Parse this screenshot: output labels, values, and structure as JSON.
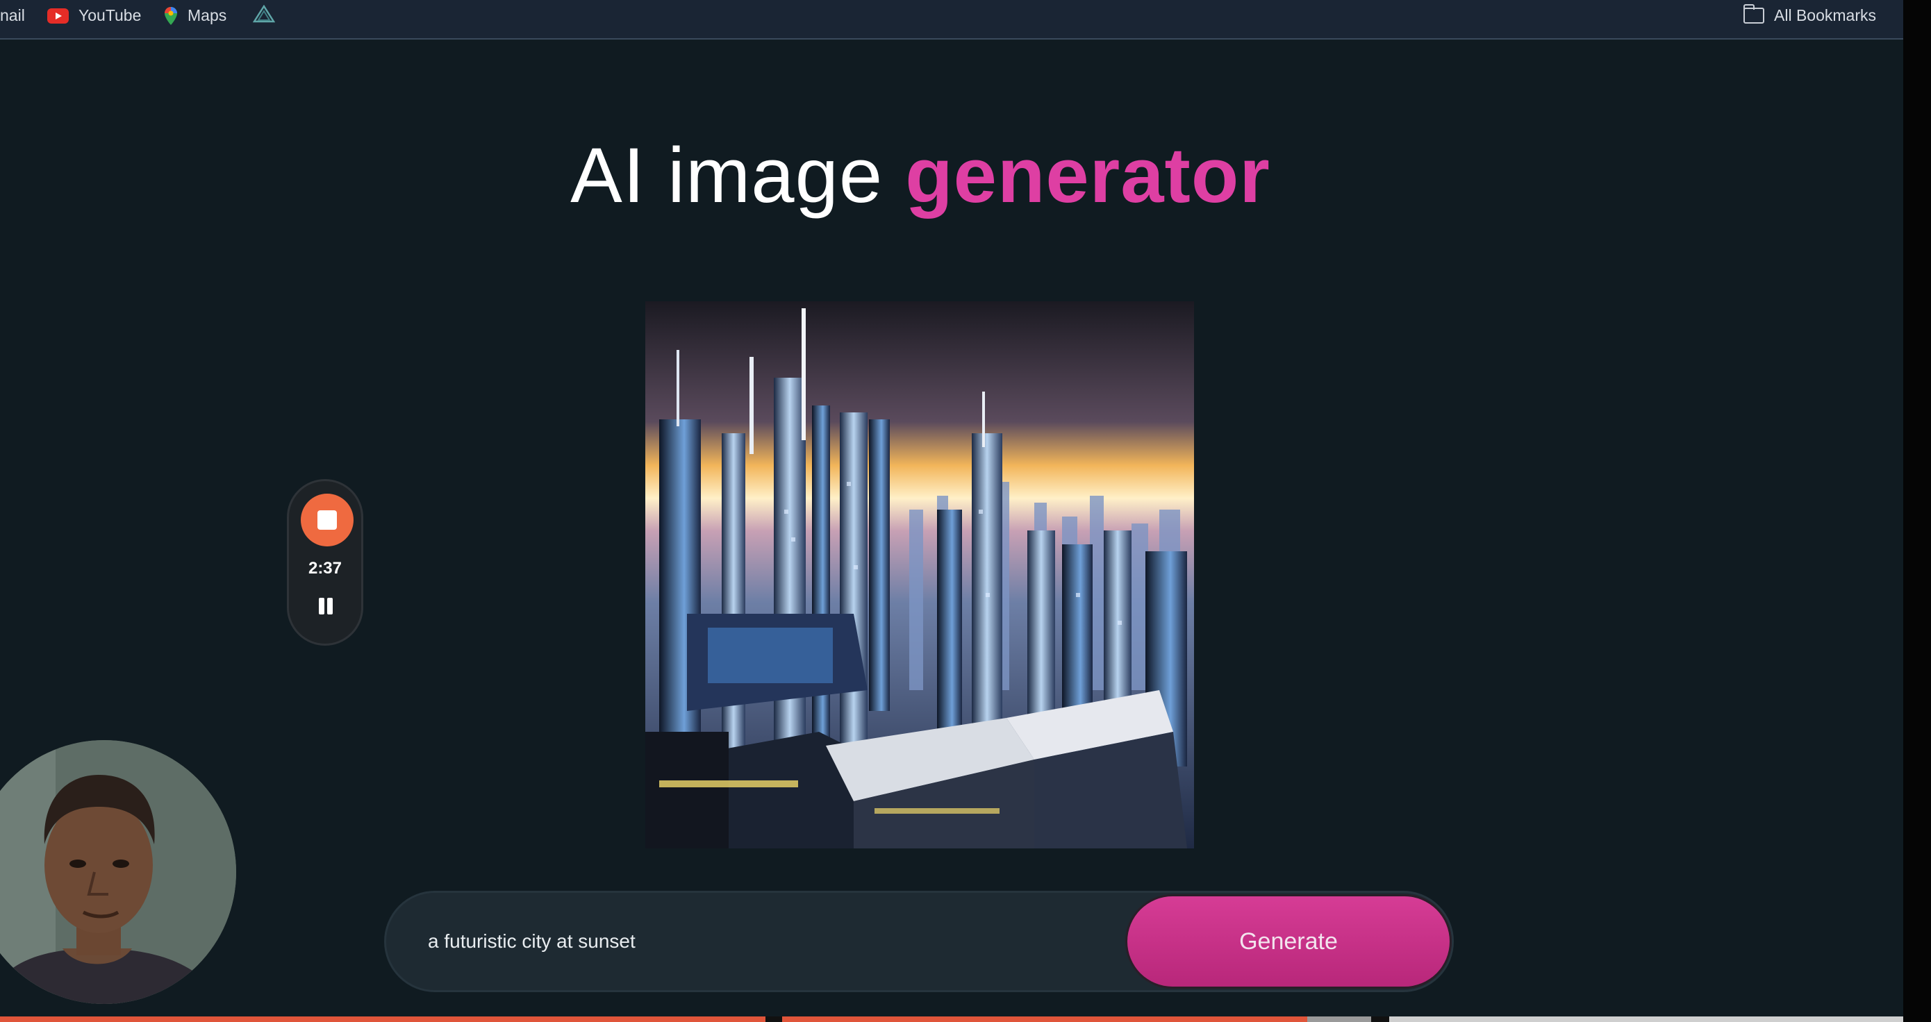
{
  "bookmarks": {
    "items": [
      {
        "label": "nail",
        "icon": "gmail-icon"
      },
      {
        "label": "YouTube",
        "icon": "youtube-icon"
      },
      {
        "label": "Maps",
        "icon": "maps-pin-icon"
      },
      {
        "label": "",
        "icon": "triangle-app-icon"
      }
    ],
    "all_bookmarks_label": "All Bookmarks"
  },
  "title": {
    "part1": "AI image ",
    "part2": "generator",
    "accent_color": "#de3fa3"
  },
  "generated_image": {
    "subject": "futuristic city at sunset"
  },
  "recorder": {
    "time": "2:37",
    "stop_color": "#ef6a40"
  },
  "prompt": {
    "value": "a futuristic city at sunset",
    "generate_label": "Generate"
  },
  "progress": {
    "colors": [
      "#e0553a",
      "#e0553a",
      "#9a9a9a",
      "#cfcfcf"
    ]
  }
}
